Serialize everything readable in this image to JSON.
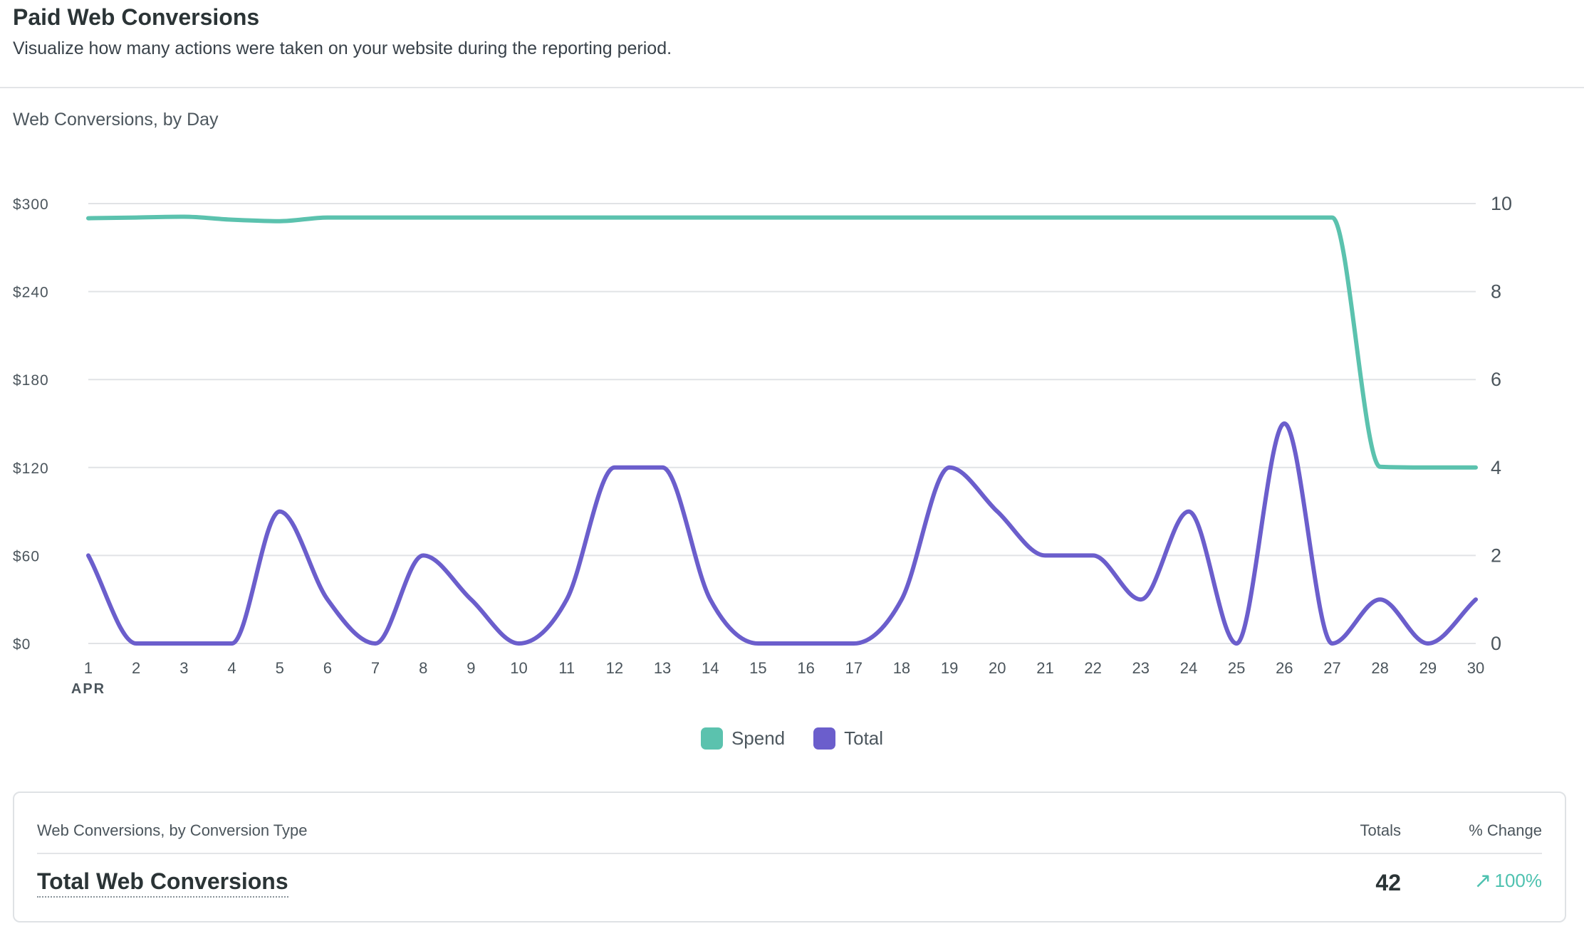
{
  "header": {
    "title": "Paid Web Conversions",
    "subtitle": "Visualize how many actions were taken on your website during the reporting period."
  },
  "chart_data": {
    "type": "line",
    "title": "Web Conversions, by Day",
    "x": [
      1,
      2,
      3,
      4,
      5,
      6,
      7,
      8,
      9,
      10,
      11,
      12,
      13,
      14,
      15,
      16,
      17,
      18,
      19,
      20,
      21,
      22,
      23,
      24,
      25,
      26,
      27,
      28,
      29,
      30
    ],
    "x_sublabel": "APR",
    "left_axis": {
      "ticks": [
        "$0",
        "$60",
        "$120",
        "$180",
        "$240",
        "$300"
      ],
      "ylim": [
        0,
        300
      ]
    },
    "right_axis": {
      "ticks": [
        "0",
        "2",
        "4",
        "6",
        "8",
        "10"
      ],
      "ylim": [
        0,
        10
      ]
    },
    "grid": true,
    "legend_position": "bottom-center",
    "series": [
      {
        "name": "Spend",
        "axis": "left",
        "color": "#5bc2ae",
        "values": [
          290,
          290.5,
          291,
          289,
          288,
          290.5,
          290.5,
          290.5,
          290.5,
          290.5,
          290.5,
          290.5,
          290.5,
          290.5,
          290.5,
          290.5,
          290.5,
          290.5,
          290.5,
          290.5,
          290.5,
          290.5,
          290.5,
          290.5,
          290.5,
          290.5,
          290.5,
          120.5,
          120,
          120
        ]
      },
      {
        "name": "Total",
        "axis": "right",
        "color": "#6b5ecc",
        "values": [
          2,
          0,
          0,
          0,
          3,
          1,
          0,
          2,
          1,
          0,
          1,
          4,
          4,
          1,
          0,
          0,
          0,
          1,
          4,
          3,
          2,
          2,
          1,
          3,
          0,
          5,
          0,
          1,
          0,
          1
        ]
      }
    ]
  },
  "panel": {
    "heading": "Web Conversions, by Conversion Type",
    "col_totals": "Totals",
    "col_change": "% Change",
    "row_label": "Total Web Conversions",
    "row_total": "42",
    "row_change": "100%",
    "change_icon": "arrow-up-right-icon",
    "change_color": "#4fc2b0"
  }
}
